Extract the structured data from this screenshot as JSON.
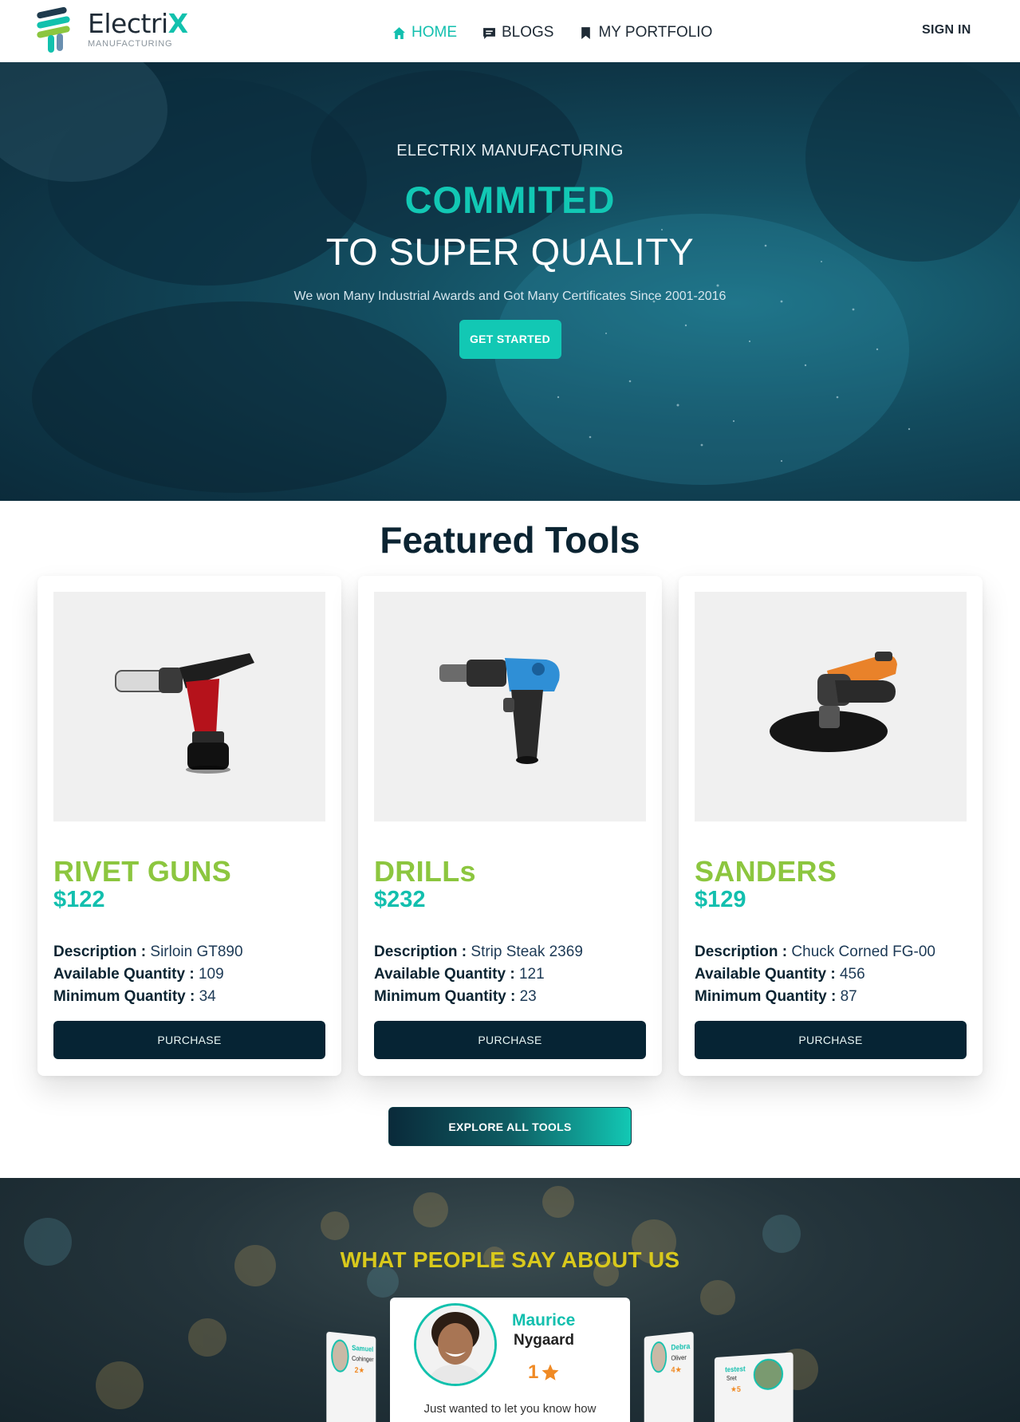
{
  "brand": {
    "name_prefix": "Electri",
    "name_accent": "X",
    "tagline": "MANUFACTURING"
  },
  "nav": {
    "links": [
      {
        "label": "HOME",
        "icon": "home-icon",
        "active": true
      },
      {
        "label": "BLOGS",
        "icon": "message-icon",
        "active": false
      },
      {
        "label": "MY PORTFOLIO",
        "icon": "bookmark-icon",
        "active": false
      }
    ],
    "signin": "SIGN IN"
  },
  "hero": {
    "kicker": "ELECTRIX MANUFACTURING",
    "title": "COMMITED",
    "subtitle": "TO SUPER QUALITY",
    "text": "We won Many Industrial Awards and Got Many Certificates Since 2001-2016",
    "cta": "GET STARTED"
  },
  "featured": {
    "title": "Featured Tools",
    "labels": {
      "description": "Description :",
      "available": "Available Quantity :",
      "minimum": "Minimum Quantity :",
      "purchase": "PURCHASE"
    },
    "tools": [
      {
        "name": "RIVET GUNS",
        "price": "$122",
        "description": "Sirloin GT890",
        "available": "109",
        "minimum": "34"
      },
      {
        "name": "DRILLs",
        "price": "$232",
        "description": "Strip Steak 2369",
        "available": "121",
        "minimum": "23"
      },
      {
        "name": "SANDERS",
        "price": "$129",
        "description": "Chuck Corned FG-00",
        "available": "456",
        "minimum": "87"
      }
    ],
    "explore": "EXPLORE ALL TOOLS"
  },
  "testimonials": {
    "title": "WHAT PEOPLE SAY ABOUT US",
    "main": {
      "first": "Maurice",
      "last": "Nygaard",
      "rating": "1",
      "quote": "Just wanted to let you know how"
    },
    "side": [
      {
        "first": "Samuel",
        "last": "Cohinger",
        "rating": "2"
      },
      {
        "first": "Debra",
        "last": "Oliver",
        "rating": "4"
      },
      {
        "first": "testest",
        "last": "Sret",
        "rating": "5"
      }
    ],
    "colors": {
      "accent": "#12c1ad",
      "title": "#d9c91c",
      "star": "#f08a24"
    }
  },
  "colors": {
    "teal": "#12c8b4",
    "green": "#8cc63f",
    "navy": "#062434"
  }
}
